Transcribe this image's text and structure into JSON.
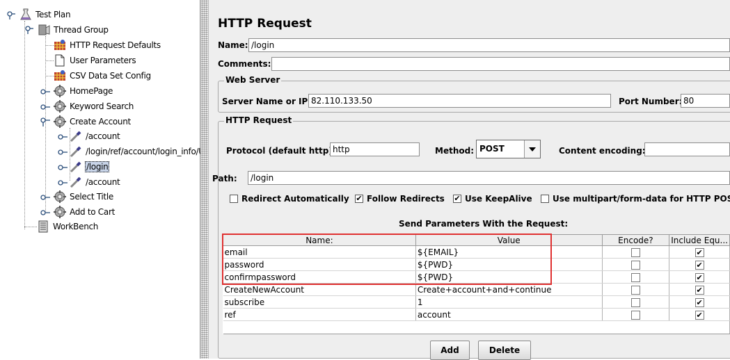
{
  "tree": {
    "items": [
      {
        "label": "Test Plan",
        "icon": "flask-icon"
      },
      {
        "label": "Thread Group",
        "icon": "spool-icon"
      },
      {
        "label": "HTTP Request Defaults",
        "icon": "config-element-icon"
      },
      {
        "label": "User Parameters",
        "icon": "document-icon"
      },
      {
        "label": "CSV Data Set Config",
        "icon": "config-element-icon"
      },
      {
        "label": "HomePage",
        "icon": "controller-icon"
      },
      {
        "label": "Keyword Search",
        "icon": "controller-icon"
      },
      {
        "label": "Create Account",
        "icon": "controller-icon"
      },
      {
        "label": "/account",
        "icon": "sampler-pipette-icon"
      },
      {
        "label": "/login/ref/account/login_info/U",
        "icon": "sampler-pipette-icon"
      },
      {
        "label": "/login",
        "icon": "sampler-pipette-icon"
      },
      {
        "label": "/account",
        "icon": "sampler-pipette-icon"
      },
      {
        "label": "Select Title",
        "icon": "controller-icon"
      },
      {
        "label": "Add to Cart",
        "icon": "controller-icon"
      },
      {
        "label": "WorkBench",
        "icon": "workbench-icon"
      }
    ]
  },
  "panel": {
    "title": "HTTP Request",
    "name_label": "Name:",
    "name_value": "/login",
    "comments_label": "Comments:",
    "web_server": {
      "title": "Web Server",
      "server_label": "Server Name or IP:",
      "server_value": "82.110.133.50",
      "port_label": "Port Number:",
      "port_value": "80"
    },
    "http_request": {
      "title": "HTTP Request",
      "protocol_label": "Protocol (default http):",
      "protocol_value": "http",
      "method_label": "Method:",
      "method_value": "POST",
      "encoding_label": "Content encoding:",
      "encoding_value": "",
      "path_label": "Path:",
      "path_value": "/login"
    },
    "options": {
      "redirect_auto": "Redirect Automatically",
      "follow_redirects": "Follow Redirects",
      "keepalive": "Use KeepAlive",
      "multipart": "Use multipart/form-data for HTTP POST",
      "states": {
        "redirect_auto": false,
        "follow_redirects": true,
        "keepalive": true,
        "multipart": false
      }
    },
    "params": {
      "title": "Send Parameters With the Request:",
      "headers": [
        "Name:",
        "Value",
        "Encode?",
        "Include Equ..."
      ],
      "rows": [
        {
          "name": "email",
          "value": "${EMAIL}",
          "encode": false,
          "include": true
        },
        {
          "name": "password",
          "value": "${PWD}",
          "encode": false,
          "include": true
        },
        {
          "name": "confirmpassword",
          "value": "${PWD}",
          "encode": false,
          "include": true
        },
        {
          "name": "CreateNewAccount",
          "value": "Create+account+and+continue",
          "encode": false,
          "include": true
        },
        {
          "name": "subscribe",
          "value": "1",
          "encode": false,
          "include": true
        },
        {
          "name": "ref",
          "value": "account",
          "encode": false,
          "include": true
        }
      ]
    },
    "buttons": {
      "add": "Add",
      "delete": "Delete"
    },
    "highlight_color": "#e03030"
  }
}
